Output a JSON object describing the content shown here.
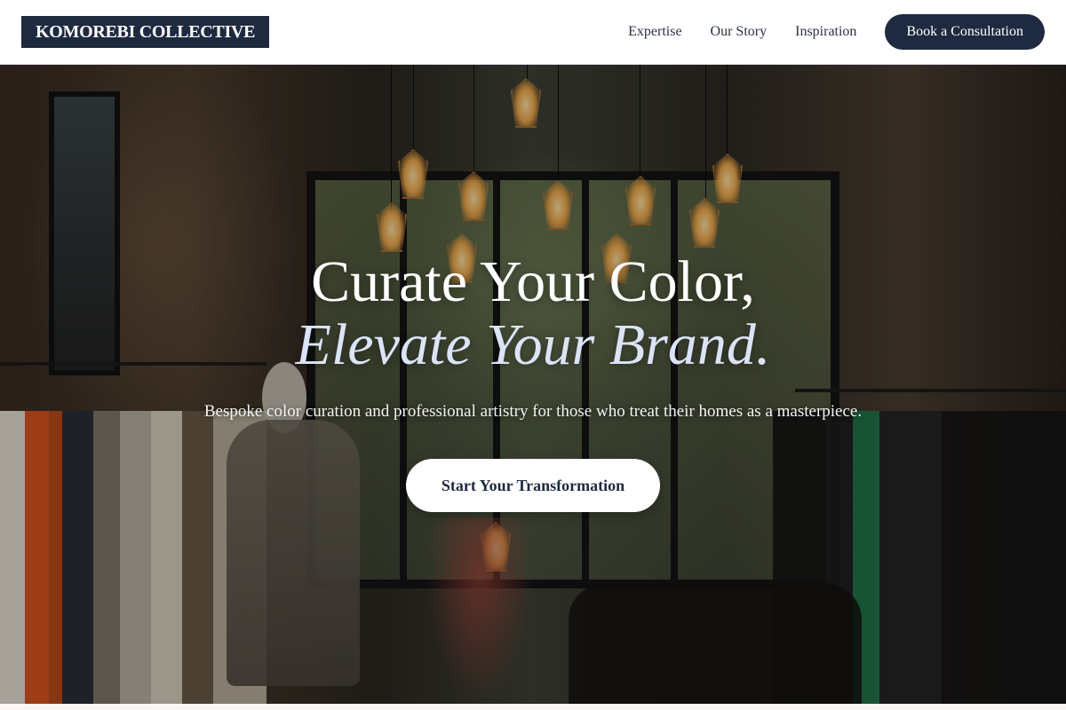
{
  "header": {
    "logo": "KOMOREBI COLLECTIVE",
    "nav": [
      {
        "label": "Expertise"
      },
      {
        "label": "Our Story"
      },
      {
        "label": "Inspiration"
      }
    ],
    "cta": "Book a Consultation"
  },
  "hero": {
    "title_line1": "Curate Your Color,",
    "title_line2": "Elevate Your Brand.",
    "subtitle": "Bespoke color curation and professional artistry for those who treat their homes as a masterpiece.",
    "button": "Start Your Transformation"
  },
  "colors": {
    "brand_navy": "#1f2a40",
    "title_italic": "#dbe4f7",
    "white": "#ffffff"
  }
}
